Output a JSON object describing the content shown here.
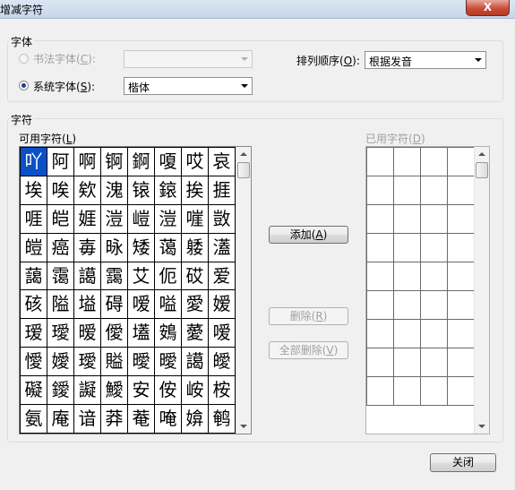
{
  "window": {
    "title": "增减字符",
    "close_label": "X"
  },
  "font_group": {
    "label": "字体",
    "calligraphy_radio": {
      "label": "书法字体",
      "shortcut": "C",
      "checked": false,
      "enabled": false
    },
    "calligraphy_combo": {
      "value": ""
    },
    "system_radio": {
      "label": "系统字体",
      "shortcut": "S",
      "checked": true
    },
    "system_combo": {
      "value": "楷体"
    },
    "sort_label": "排列顺序",
    "sort_shortcut": "O",
    "sort_combo": {
      "value": "根据发音"
    }
  },
  "chars_group": {
    "label": "字符",
    "available_label": "可用字符",
    "available_shortcut": "L",
    "used_label": "已用字符",
    "used_shortcut": "D",
    "available_chars": [
      "吖",
      "阿",
      "啊",
      "锕",
      "錒",
      "嗄",
      "哎",
      "哀",
      "埃",
      "唉",
      "欸",
      "溾",
      "锿",
      "鎄",
      "挨",
      "捱",
      "啀",
      "皑",
      "娾",
      "溰",
      "嵦",
      "溰",
      "嘊",
      "敳",
      "皚",
      "癌",
      "毐",
      "昹",
      "矮",
      "蔼",
      "躷",
      "濭",
      "藹",
      "霭",
      "譪",
      "靄",
      "艾",
      "伌",
      "砹",
      "爱",
      "硋",
      "隘",
      "塧",
      "碍",
      "嗳",
      "嗌",
      "愛",
      "嫒",
      "瑷",
      "璦",
      "暧",
      "僾",
      "壒",
      "鴳",
      "薆",
      "嗳",
      "懓",
      "嬡",
      "璦",
      "賹",
      "曖",
      "曖",
      "譪",
      "皧",
      "礙",
      "鑀",
      "譺",
      "鱫",
      "安",
      "侒",
      "峖",
      "桉",
      "氨",
      "庵",
      "谙",
      "莽",
      "菴",
      "唵",
      "媕",
      "鹌"
    ],
    "selected_index": 0,
    "used_rows": 9
  },
  "buttons": {
    "add": "添加",
    "add_shortcut": "A",
    "delete": "删除",
    "delete_shortcut": "R",
    "delete_all": "全部删除",
    "delete_all_shortcut": "V",
    "close": "关闭"
  }
}
